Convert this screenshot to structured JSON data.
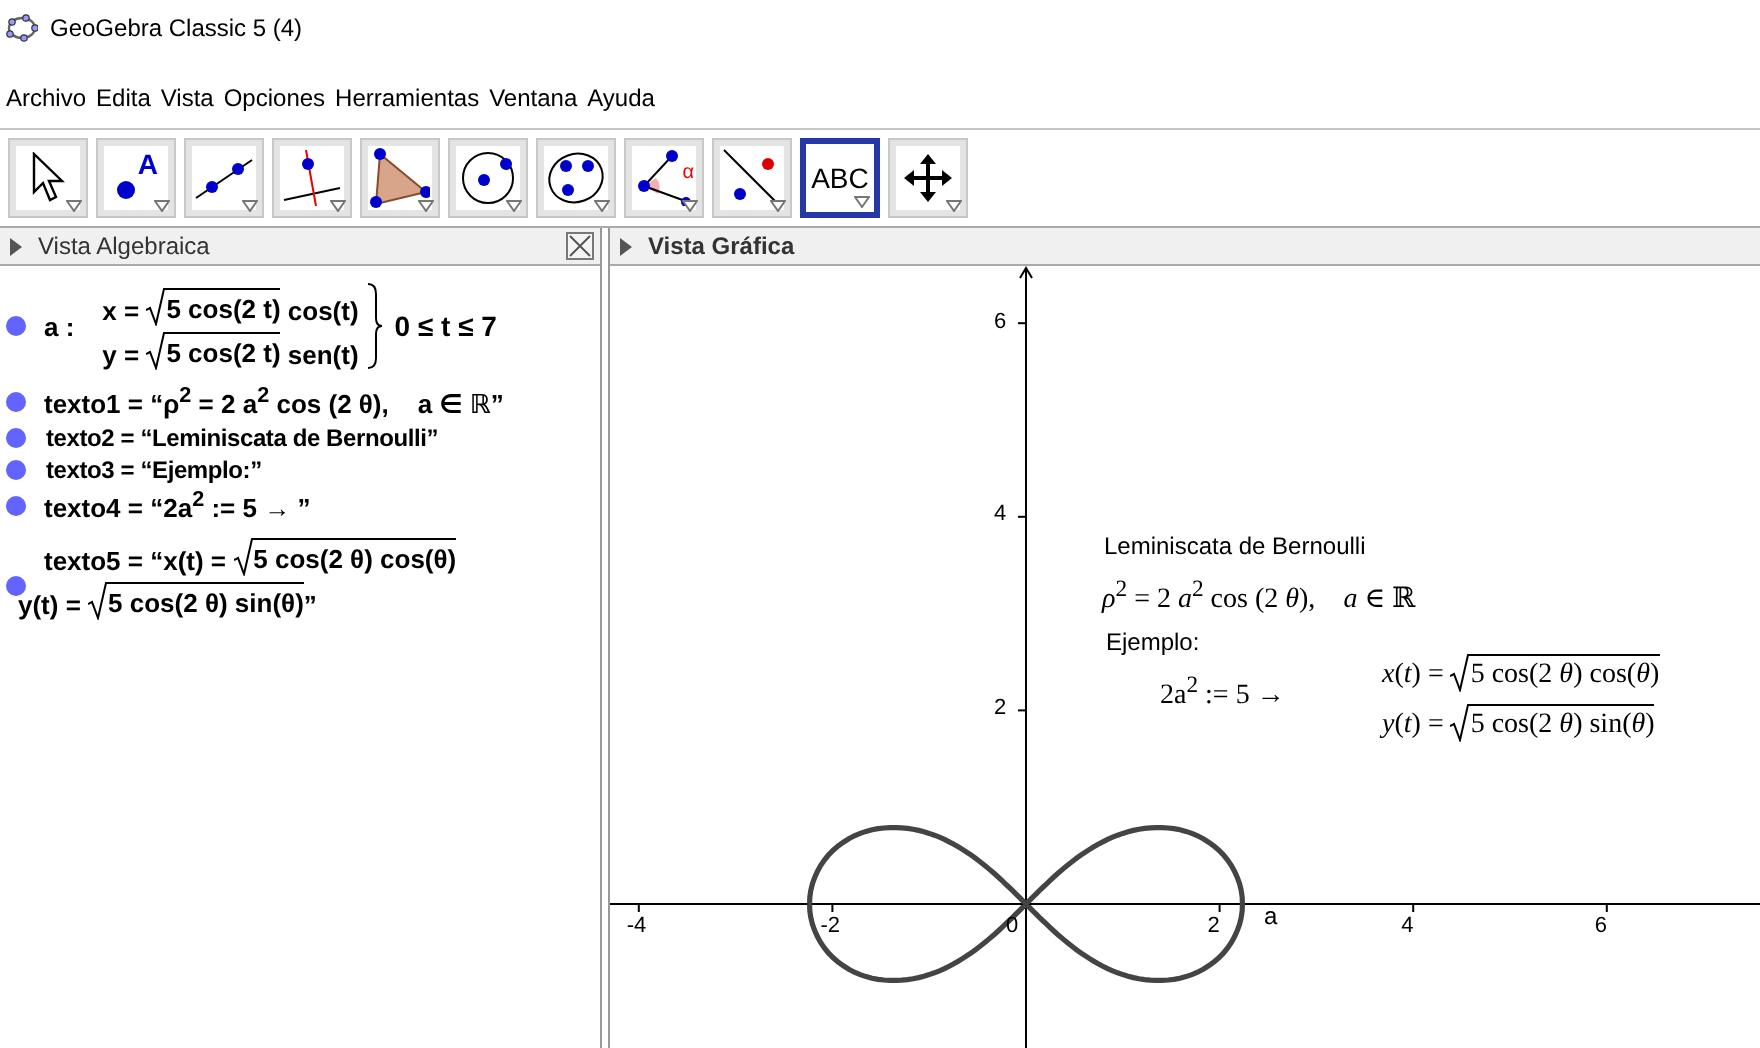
{
  "window": {
    "title": "GeoGebra Classic 5 (4)"
  },
  "menu": [
    "Archivo",
    "Edita",
    "Vista",
    "Opciones",
    "Herramientas",
    "Ventana",
    "Ayuda"
  ],
  "tools": [
    {
      "kind": "pointer",
      "selected": false
    },
    {
      "kind": "point",
      "label": "A",
      "selected": false
    },
    {
      "kind": "line",
      "selected": false
    },
    {
      "kind": "perpendicular",
      "selected": false
    },
    {
      "kind": "polygon",
      "selected": false
    },
    {
      "kind": "circle",
      "selected": false
    },
    {
      "kind": "conic",
      "selected": false
    },
    {
      "kind": "angle",
      "label": "α",
      "selected": false
    },
    {
      "kind": "reflection",
      "selected": false
    },
    {
      "kind": "text",
      "label": "ABC",
      "selected": true
    },
    {
      "kind": "pan",
      "selected": false
    }
  ],
  "algebra_view": {
    "title": "Vista Algebraica",
    "items": [
      {
        "kind": "curve",
        "name": "a :",
        "lines": [
          {
            "prefix": "x = ",
            "radicand": "5 cos(2 t)",
            "suffix": " cos(t)"
          },
          {
            "prefix": "y = ",
            "radicand": "5 cos(2 t)",
            "suffix": " sen(t)"
          }
        ],
        "range": "0 ≤ t ≤ 7"
      },
      {
        "kind": "latex",
        "text": "texto1 = “ρ$^{2}$ = 2 a$^{2}$ cos (2 θ),    a ∈ ℝ”"
      },
      {
        "kind": "plain",
        "text": "texto2 = “Leminiscata de Bernoulli”"
      },
      {
        "kind": "plain",
        "text": "texto3 = “Ejemplo:”"
      },
      {
        "kind": "latex",
        "text": "texto4 = “2a$^{2}$ := 5 → ”"
      },
      {
        "kind": "radicals",
        "lines": [
          {
            "prefix": "texto5 = “x(t) = ",
            "radicand": "5 cos(2 θ) cos(θ)"
          },
          {
            "prefix": "y(t) = ",
            "radicand": "5 cos(2 θ) sin(θ)",
            "suffix": "”"
          }
        ]
      }
    ]
  },
  "graphics_view": {
    "title": "Vista Gráfica",
    "x_ticks": [
      "-4",
      "-2",
      "0",
      "2",
      "4",
      "6"
    ],
    "y_ticks": [
      "6",
      "4",
      "2"
    ],
    "curve_label": "a",
    "texts": [
      {
        "kind": "plain",
        "text": "Leminiscata de Bernoulli"
      },
      {
        "kind": "math",
        "text": "*ρ*$^{2}$ = 2 *a*$^{2}$ cos (2 *θ*),    *a* ∈ ℝ"
      },
      {
        "kind": "plain",
        "text": "Ejemplo:"
      },
      {
        "kind": "math",
        "text": "2a$^{2}$ := 5 →"
      },
      {
        "kind": "radicals",
        "lines": [
          {
            "prefix": "*x*(*t*) = ",
            "radicand": "5 cos(2 *θ*) cos(*θ*)"
          },
          {
            "prefix": "*y*(*t*) = ",
            "radicand": "5 cos(2 *θ*) sin(*θ*)"
          }
        ]
      }
    ]
  }
}
